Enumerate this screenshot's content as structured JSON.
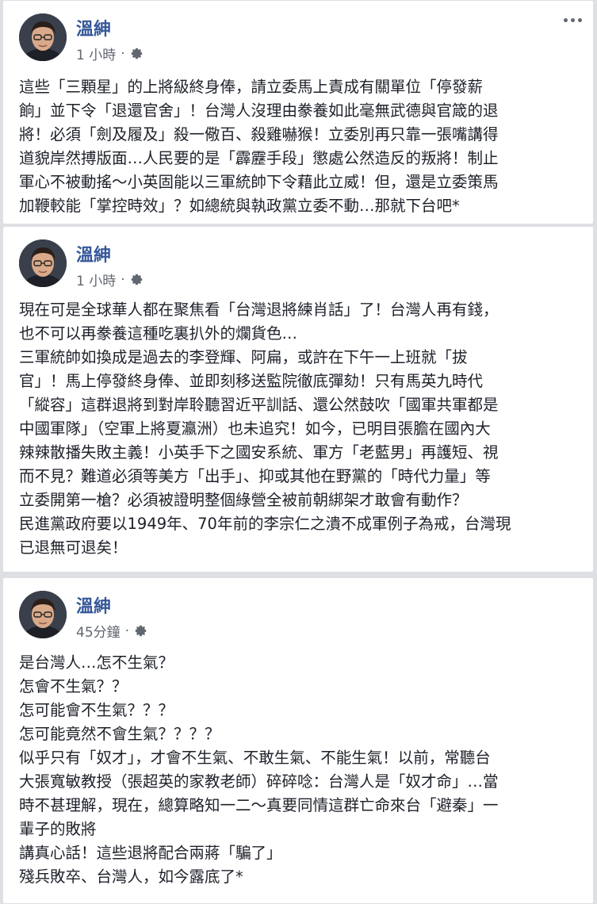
{
  "posts": [
    {
      "author": "溫紳",
      "time": "1 小時",
      "lines": [
        "這些「三顆星」的上將級終身俸，請立委馬上責成有關單位「停發薪",
        "餉」並下令「退還官舍」！台灣人沒理由豢養如此毫無武德與官箴的退",
        "將！必須「劍及履及」殺一儆百、殺雞嚇猴！立委別再只靠一張嘴講得",
        "道貌岸然搏版面…人民要的是「霹靂手段」懲處公然造反的叛將！制止",
        "軍心不被動搖～小英固能以三軍統帥下令藉此立威！但，還是立委策馬",
        "加鞭較能「掌控時效」？如總統與執政黨立委不動…那就下台吧*"
      ]
    },
    {
      "author": "溫紳",
      "time": "1 小時",
      "lines": [
        "現在可是全球華人都在聚焦看「台灣退將練肖話」了！台灣人再有錢，",
        "也不可以再豢養這種吃裏扒外的爛貨色…",
        "三軍統帥如換成是過去的李登輝、阿扁，或許在下午一上班就「拔",
        "官」！馬上停發終身俸、並即刻移送監院徹底彈劾！只有馬英九時代",
        "「縱容」這群退將到對岸聆聽習近平訓話、還公然鼓吹「國軍共軍都是",
        "中國軍隊」（空軍上將夏瀛洲）也未追究！如今，已明目張膽在國內大",
        "辣辣散播失敗主義！小英手下之國安系統、軍方「老藍男」再護短、視",
        "而不見？難道必須等美方「出手」、抑或其他在野黨的「時代力量」等",
        "立委開第一槍？必須被證明整個綠營全被前朝綁架才敢會有動作？",
        "民進黨政府要以1949年、70年前的李宗仁之潰不成軍例子為戒，台灣現",
        "已退無可退矣！"
      ]
    },
    {
      "author": "溫紳",
      "time": "45分鐘",
      "lines": [
        "是台灣人…怎不生氣？",
        "怎會不生氣？？",
        "怎可能會不生氣？？？",
        "怎可能竟然不會生氣？？？？",
        "似乎只有「奴才」，才會不生氣、不敢生氣、不能生氣！以前，常聽台",
        "大張寬敏教授（張超英的家教老師）碎碎唸：台灣人是「奴才命」…當",
        "時不甚理解，現在，總算略知一二～真要同情這群亡命來台「避秦」一",
        "輩子的敗將",
        "講真心話！這些退將配合兩蔣「騙了」",
        "殘兵敗卒、台灣人，如今露底了*"
      ]
    }
  ]
}
